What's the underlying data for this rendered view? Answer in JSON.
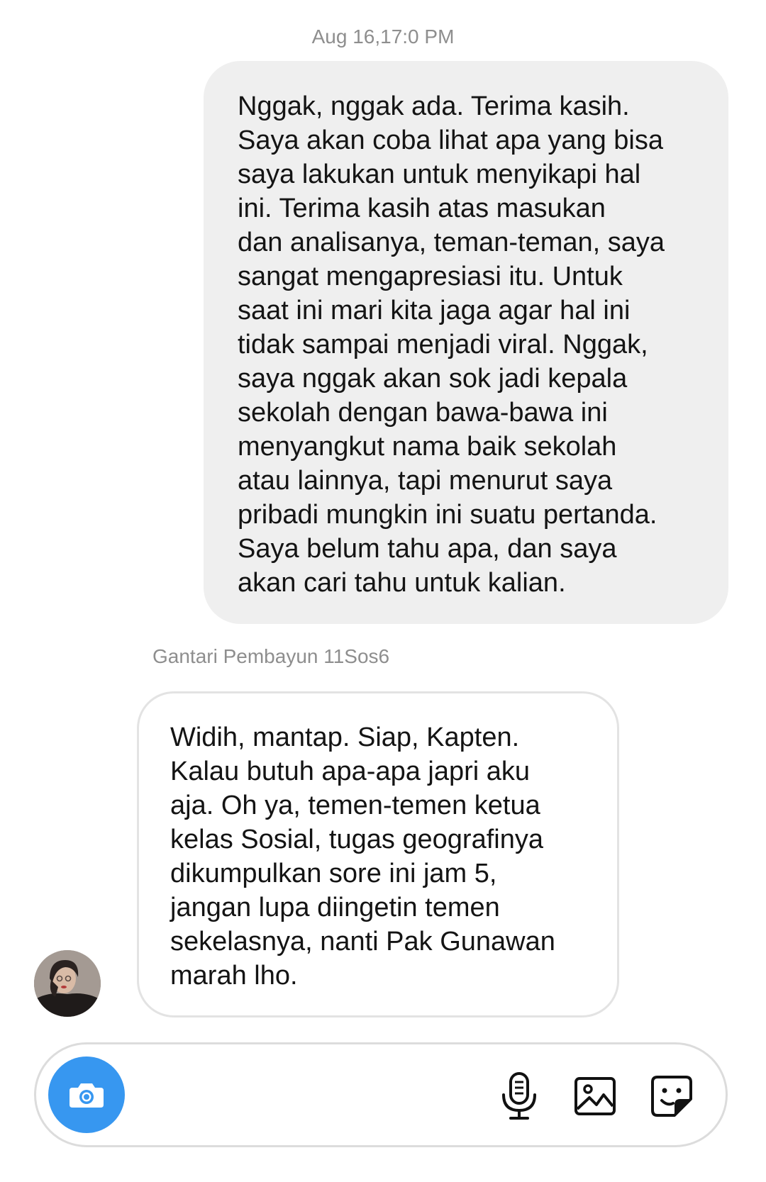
{
  "thread": {
    "timestamp": "Aug 16,17:0 PM"
  },
  "messages": [
    {
      "direction": "outgoing",
      "text": "Nggak, nggak ada. Terima kasih.\nSaya akan coba lihat apa yang bisa\nsaya lakukan untuk menyikapi hal\nini. Terima kasih atas masukan\ndan analisanya, teman-teman, saya\nsangat mengapresiasi itu. Untuk\nsaat ini mari kita jaga agar hal ini\ntidak sampai menjadi viral. Nggak,\nsaya nggak akan sok jadi kepala\nsekolah dengan bawa-bawa ini\nmenyangkut nama baik sekolah\natau lainnya, tapi menurut saya\npribadi mungkin ini suatu pertanda.\nSaya belum tahu apa, dan saya\nakan cari tahu untuk kalian."
    },
    {
      "direction": "incoming",
      "sender": "Gantari Pembayun 11Sos6",
      "text": "Widih, mantap. Siap, Kapten.\nKalau butuh apa-apa japri aku\naja. Oh ya, temen-temen ketua\nkelas Sosial, tugas geografinya\ndikumpulkan sore ini jam 5,\njangan lupa diingetin temen\nsekelasnya, nanti Pak Gunawan\nmarah lho."
    }
  ],
  "composer": {
    "icons": [
      "camera-icon",
      "microphone-icon",
      "gallery-icon",
      "sticker-icon"
    ],
    "accent_color": "#3797f0"
  }
}
